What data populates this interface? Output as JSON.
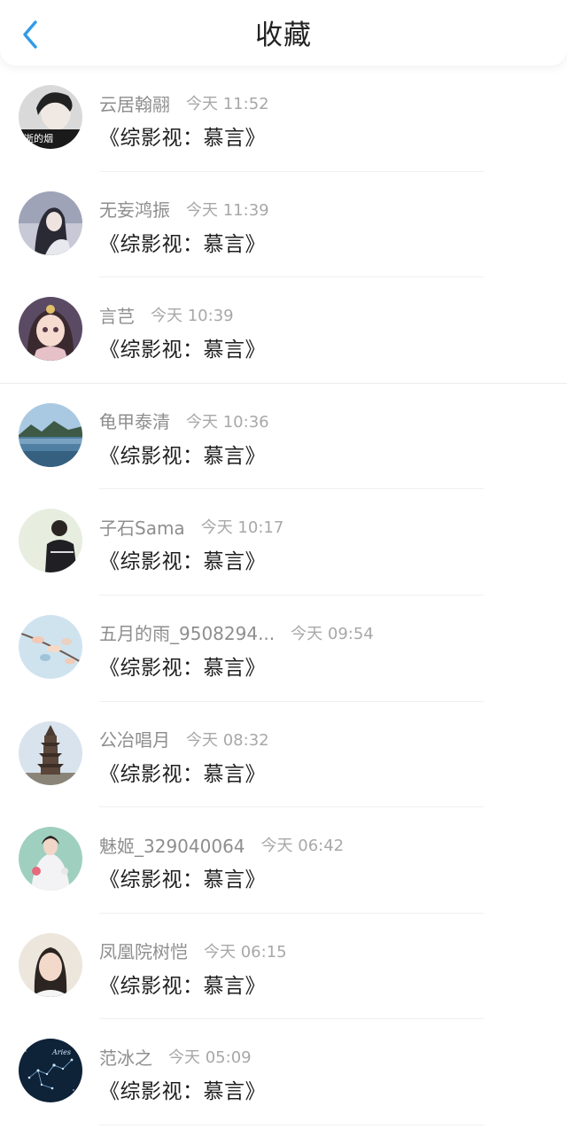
{
  "header": {
    "title": "收藏"
  },
  "favorites": [
    {
      "name": "云居翰翮",
      "time": "今天 11:52",
      "book": "《综影视：慕言》",
      "avatar_overlay_text": "逝的烟"
    },
    {
      "name": "无妄鸿振",
      "time": "今天 11:39",
      "book": "《综影视：慕言》"
    },
    {
      "name": "言芑",
      "time": "今天 10:39",
      "book": "《综影视：慕言》"
    },
    {
      "name": "龟甲泰清",
      "time": "今天 10:36",
      "book": "《综影视：慕言》"
    },
    {
      "name": "子石Sama",
      "time": "今天 10:17",
      "book": "《综影视：慕言》"
    },
    {
      "name": "五月的雨_9508294...",
      "time": "今天 09:54",
      "book": "《综影视：慕言》"
    },
    {
      "name": "公冶唱月",
      "time": "今天 08:32",
      "book": "《综影视：慕言》"
    },
    {
      "name": "魅姬_329040064",
      "time": "今天 06:42",
      "book": "《综影视：慕言》"
    },
    {
      "name": "凤凰院树恺",
      "time": "今天 06:15",
      "book": "《综影视：慕言》"
    },
    {
      "name": "范冰之",
      "time": "今天 05:09",
      "book": "《综影视：慕言》",
      "avatar_overlay_text": "Aries"
    }
  ],
  "colors": {
    "accent": "#2f9be8",
    "name_text": "#8e8e8e",
    "time_text": "#a8a8a8",
    "title_text": "#222222"
  }
}
